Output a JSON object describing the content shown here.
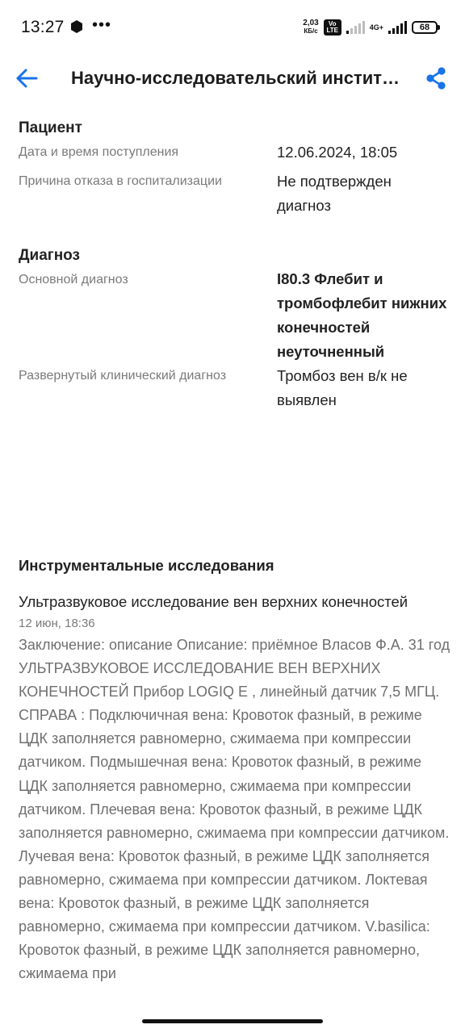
{
  "status_bar": {
    "time": "13:27",
    "dots": "•••",
    "net_speed_value": "2,03",
    "net_speed_unit": "КБ/с",
    "volte": "Vo LTE",
    "network": "4G+",
    "battery": "68"
  },
  "header": {
    "title": "Научно-исследовательский инстит…",
    "icons": {
      "back": "arrow-left-icon",
      "share": "share-icon"
    },
    "accent_color": "#1a73e8"
  },
  "patient": {
    "title": "Пациент",
    "rows": [
      {
        "label": "Дата и время поступления",
        "value": "12.06.2024, 18:05"
      },
      {
        "label": "Причина отказа в госпитализации",
        "value": "Не подтвержден диагноз"
      }
    ]
  },
  "diagnosis": {
    "title": "Диагноз",
    "rows": [
      {
        "label": "Основной диагноз",
        "value": "I80.3 Флебит и тромбофлебит нижних конечностей неуточненный"
      },
      {
        "label": "Развернутый клинический диагноз",
        "value": "Тромбоз вен в/к не выявлен"
      }
    ]
  },
  "instrumental": {
    "title": "Инструментальные исследования",
    "study": {
      "title": "Ультразвуковое исследование вен верхних конечностей",
      "date": "12 июн, 18:36",
      "text": "Заключение: описание Описание: приёмное Власов Ф.А. 31 год УЛЬТРАЗВУКОВОЕ ИССЛЕДОВАНИЕ ВЕН ВЕРХНИХ КОНЕЧНОСТЕЙ Прибор LOGIQ E , линейный датчик 7,5 МГЦ. СПРАВА : Подключичная вена: Кровоток фазный, в режиме ЦДК заполняется равномерно, сжимаема при компрессии датчиком. Подмышечная вена: Кровоток фазный, в режиме ЦДК заполняется равномерно, сжимаема при компрессии датчиком. Плечевая вена: Кровоток фазный, в режиме ЦДК заполняется равномерно, сжимаема при компрессии датчиком. Лучевая вена: Кровоток фазный, в режиме ЦДК заполняется равномерно, сжимаема при компрессии датчиком. Локтевая вена: Кровоток фазный, в режиме ЦДК заполняется равномерно, сжимаема при компрессии датчиком. V.basilica: Кровоток фазный, в режиме ЦДК заполняется равномерно, сжимаема при"
    }
  }
}
